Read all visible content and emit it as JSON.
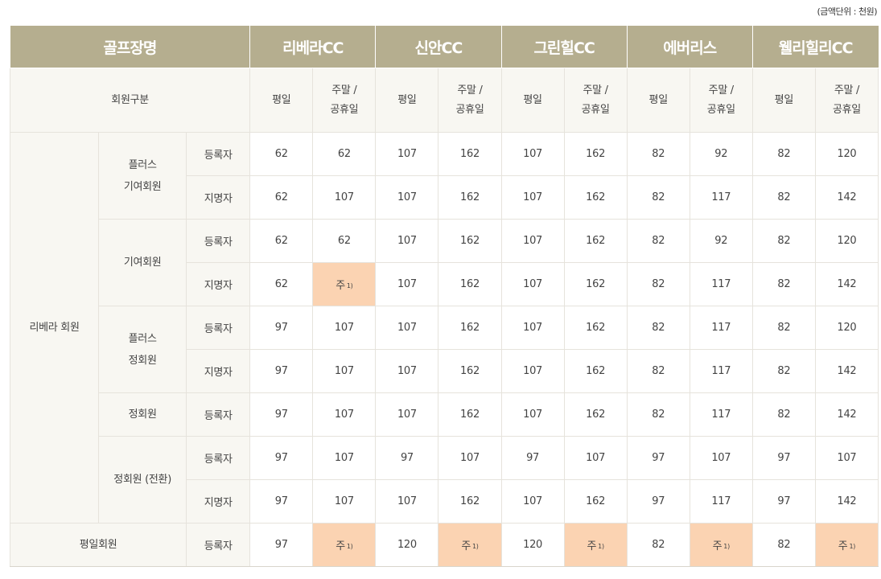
{
  "unit_note": "(금액단위 : 천원)",
  "header": {
    "course_label": "골프장명",
    "courses": [
      "리베라CC",
      "신안CC",
      "그린힐CC",
      "에버리스",
      "웰리힐리CC"
    ]
  },
  "subheader": {
    "label": "회원구분",
    "weekday": "평일",
    "weekend_line1": "주말 /",
    "weekend_line2": "공휴일"
  },
  "colors": {
    "header_bg": "#b5ae8f",
    "label_bg": "#f8f7f2",
    "note_bg": "#fbd3b2"
  },
  "groups": {
    "riviera_member": "리베라 회원",
    "plus_contrib_line1": "플러스",
    "plus_contrib_line2": "기여회원",
    "contrib": "기여회원",
    "plus_regular_line1": "플러스",
    "plus_regular_line2": "정회원",
    "regular": "정회원",
    "regular_converted": "정회원 (전환)",
    "weekday_member": "평일회원"
  },
  "note": {
    "text": "주",
    "mark": "1)"
  },
  "rows": [
    {
      "type": "등록자",
      "values": [
        "62",
        "62",
        "107",
        "162",
        "107",
        "162",
        "82",
        "92",
        "82",
        "120"
      ]
    },
    {
      "type": "지명자",
      "values": [
        "62",
        "107",
        "107",
        "162",
        "107",
        "162",
        "82",
        "117",
        "82",
        "142"
      ]
    },
    {
      "type": "등록자",
      "values": [
        "62",
        "62",
        "107",
        "162",
        "107",
        "162",
        "82",
        "92",
        "82",
        "120"
      ]
    },
    {
      "type": "지명자",
      "values": [
        "62",
        "주 1)",
        "107",
        "162",
        "107",
        "162",
        "82",
        "117",
        "82",
        "142"
      ]
    },
    {
      "type": "등록자",
      "values": [
        "97",
        "107",
        "107",
        "162",
        "107",
        "162",
        "82",
        "117",
        "82",
        "120"
      ]
    },
    {
      "type": "지명자",
      "values": [
        "97",
        "107",
        "107",
        "162",
        "107",
        "162",
        "82",
        "117",
        "82",
        "142"
      ]
    },
    {
      "type": "등록자",
      "values": [
        "97",
        "107",
        "107",
        "162",
        "107",
        "162",
        "82",
        "117",
        "82",
        "142"
      ]
    },
    {
      "type": "등록자",
      "values": [
        "97",
        "107",
        "97",
        "107",
        "97",
        "107",
        "97",
        "107",
        "97",
        "107"
      ]
    },
    {
      "type": "지명자",
      "values": [
        "97",
        "107",
        "107",
        "162",
        "107",
        "162",
        "97",
        "117",
        "97",
        "142"
      ]
    },
    {
      "type": "등록자",
      "values": [
        "97",
        "주 1)",
        "120",
        "주 1)",
        "120",
        "주 1)",
        "82",
        "주 1)",
        "82",
        "주 1)"
      ]
    }
  ]
}
